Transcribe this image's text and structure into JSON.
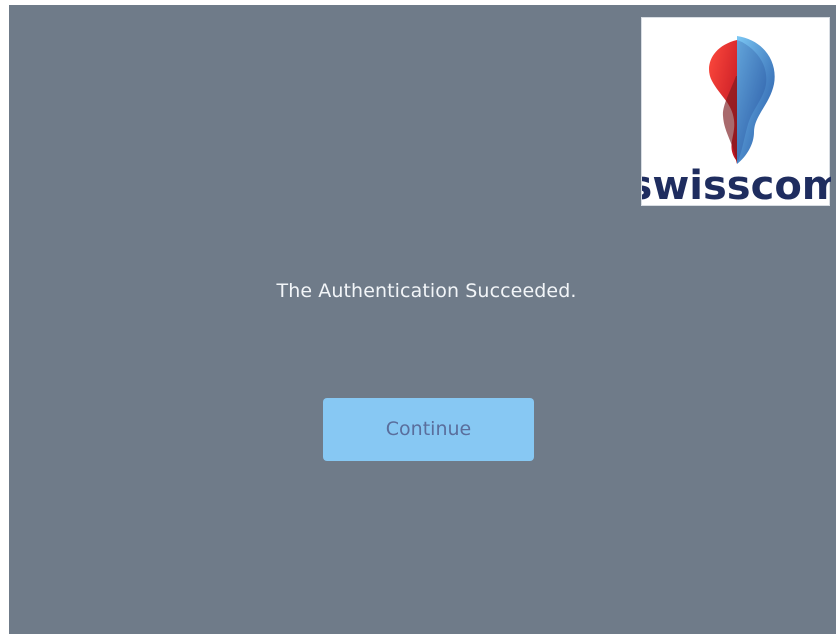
{
  "logo": {
    "brand_text": "swisscom",
    "icon": "swisscom-logo-icon"
  },
  "auth": {
    "message": "The Authentication Succeeded.",
    "continue_label": "Continue"
  },
  "colors": {
    "panel_bg": "#6f7b89",
    "button_bg": "#87c8f3",
    "button_text": "#5a6e9c",
    "message_text": "#f2f5f8",
    "logo_red": "#e32b2d",
    "logo_blue": "#2f6fb2",
    "brand_text": "#1f2d5f"
  }
}
